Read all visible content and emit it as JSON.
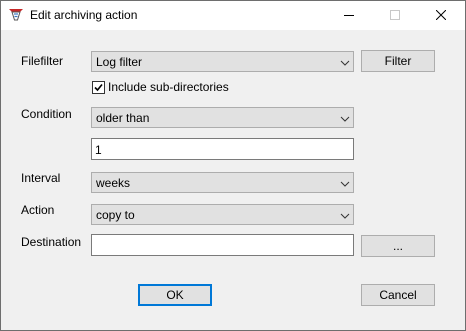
{
  "window": {
    "title": "Edit archiving action",
    "icon": "archive-app-icon",
    "controls": [
      "minimize-icon",
      "maximize-icon",
      "close-icon"
    ]
  },
  "form": {
    "filefilter": {
      "label": "Filefilter",
      "value": "Log filter",
      "button": "Filter"
    },
    "include_subdirs": {
      "label": "Include sub-directories",
      "checked": true
    },
    "condition": {
      "label": "Condition",
      "value": "older than",
      "amount": "1"
    },
    "interval": {
      "label": "Interval",
      "value": "weeks"
    },
    "action": {
      "label": "Action",
      "value": "copy to"
    },
    "destination": {
      "label": "Destination",
      "value": "",
      "browse_button": "..."
    }
  },
  "buttons": {
    "ok": "OK",
    "cancel": "Cancel"
  },
  "colors": {
    "accent": "#0078d7",
    "button_face": "#e1e1e1",
    "dialog_bg": "#f0f0f0"
  }
}
